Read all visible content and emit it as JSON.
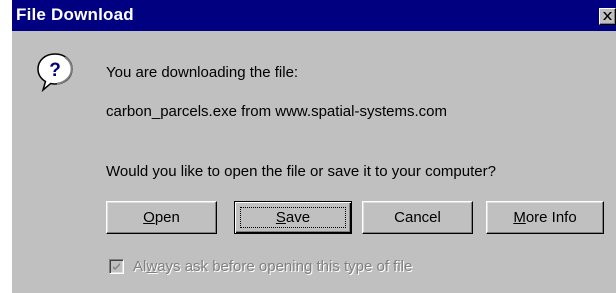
{
  "window": {
    "title": "File Download",
    "close_icon": "close-icon"
  },
  "message": {
    "icon": "question-balloon-icon",
    "line1": "You are downloading the file:",
    "file_source": "carbon_parcels.exe from www.spatial-systems.com",
    "question": "Would you like to open the file or save it to your computer?"
  },
  "buttons": {
    "open": {
      "accel": "O",
      "rest": "pen"
    },
    "save": {
      "accel": "S",
      "rest": "ave",
      "is_default": true
    },
    "cancel": {
      "label": "Cancel"
    },
    "more_info": {
      "accel": "M",
      "rest": "ore Info"
    }
  },
  "checkbox": {
    "pre": "Al",
    "accel": "w",
    "rest": "ays ask before opening this type of file",
    "checked": true,
    "enabled": false
  },
  "colors": {
    "titlebar": "#000080",
    "face": "#c0c0c0",
    "disabled_text": "#808080"
  }
}
